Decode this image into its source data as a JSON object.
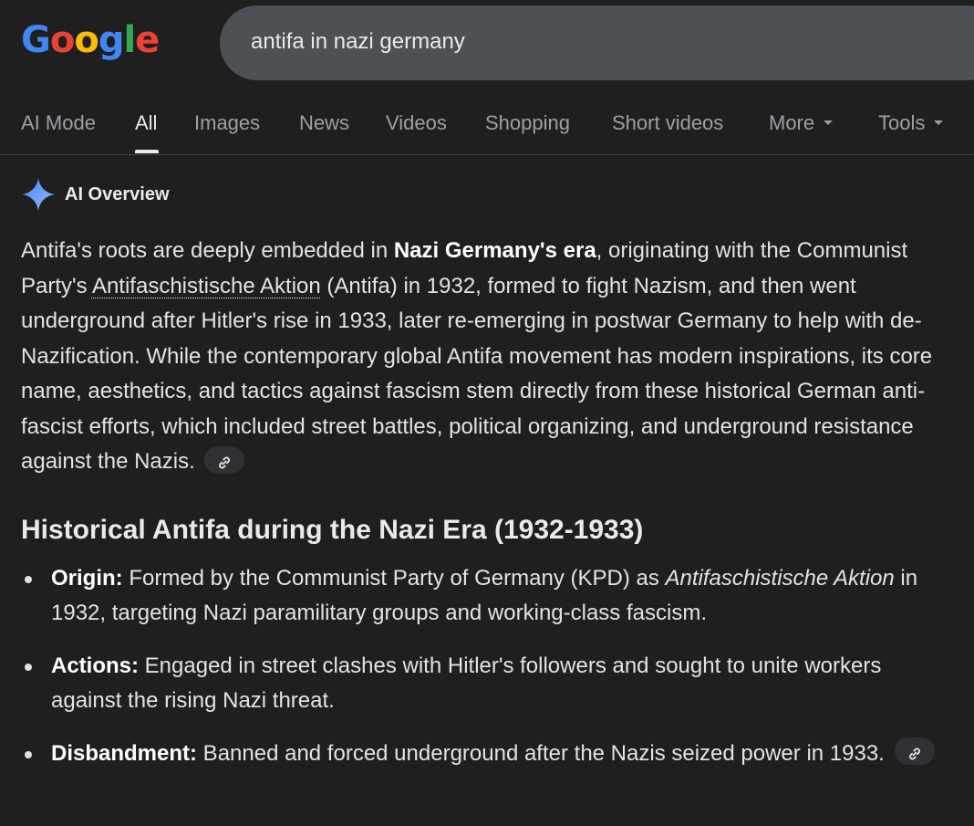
{
  "logo": {
    "text": "Google",
    "letters": [
      {
        "char": "G",
        "color": "#4285f4"
      },
      {
        "char": "o",
        "color": "#ea4335"
      },
      {
        "char": "o",
        "color": "#fbbc04"
      },
      {
        "char": "g",
        "color": "#4285f4"
      },
      {
        "char": "l",
        "color": "#34a853"
      },
      {
        "char": "e",
        "color": "#ea4335"
      }
    ]
  },
  "search": {
    "query": "antifa in nazi germany"
  },
  "tabs": [
    {
      "label": "AI Mode",
      "active": false
    },
    {
      "label": "All",
      "active": true
    },
    {
      "label": "Images",
      "active": false
    },
    {
      "label": "News",
      "active": false
    },
    {
      "label": "Videos",
      "active": false
    },
    {
      "label": "Shopping",
      "active": false
    },
    {
      "label": "Short videos",
      "active": false
    },
    {
      "label": "More",
      "active": false,
      "dropdown": true
    },
    {
      "label": "Tools",
      "active": false,
      "dropdown": true
    }
  ],
  "ai_overview": {
    "title": "AI Overview",
    "icon": "sparkle-icon",
    "paragraph": {
      "p1": "Antifa's roots are deeply embedded in ",
      "bold1": "Nazi Germany's era",
      "p2": ", originating with the Communist Party's ",
      "term": "Antifaschistische Aktion",
      "p3": " (Antifa) in 1932, formed to fight Nazism, and then went underground after Hitler's rise in 1933, later re-emerging in postwar Germany to help with de-Nazification. While the contemporary global Antifa movement has modern inspirations, its core name, aesthetics, and tactics against fascism stem directly from these historical German anti-fascist efforts, which included street battles, political organizing, and underground resistance against the Nazis."
    },
    "section_title": "Historical Antifa during the Nazi Era (1932-1933)",
    "bullets": [
      {
        "label": "Origin:",
        "text1": " Formed by the Communist Party of Germany (KPD) as ",
        "italic": "Antifaschistische Aktion",
        "text2": " in 1932, targeting Nazi paramilitary groups and working-class fascism."
      },
      {
        "label": "Actions:",
        "text1": " Engaged in street clashes with Hitler's followers and sought to unite workers against the rising Nazi threat."
      },
      {
        "label": "Disbandment:",
        "text1": " Banned and forced underground after the Nazis seized power in 1933. "
      }
    ]
  },
  "colors": {
    "background": "#1f1f1f",
    "search_box": "#4d5156",
    "text": "#e3e3e3",
    "muted": "#9aa0a6",
    "sparkle": "#8ab4f8"
  }
}
